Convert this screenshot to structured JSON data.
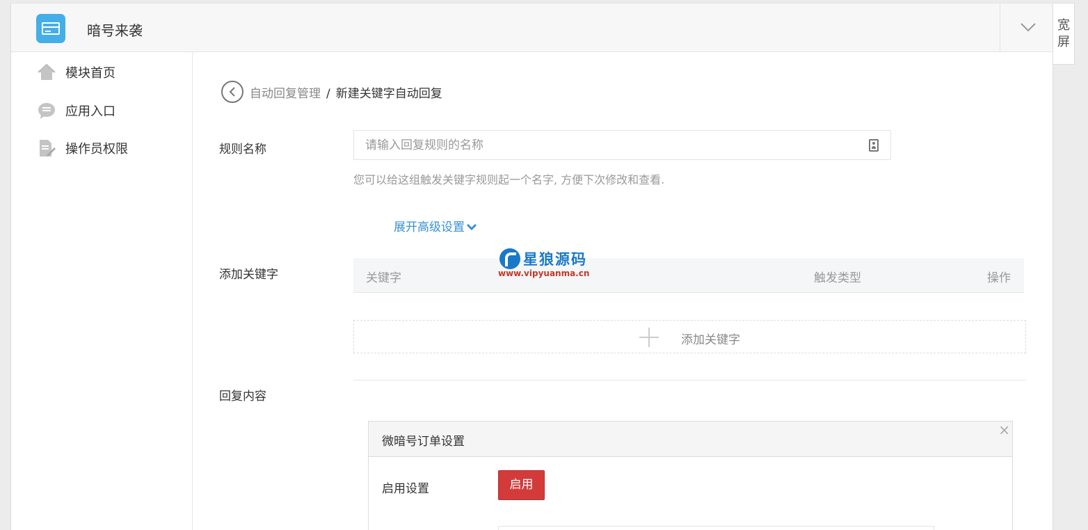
{
  "app": {
    "title": "暗号来袭",
    "widescreen_label": "宽屏"
  },
  "sidebar": {
    "items": [
      {
        "label": "模块首页",
        "icon": "home-icon"
      },
      {
        "label": "应用入口",
        "icon": "chat-icon"
      },
      {
        "label": "操作员权限",
        "icon": "edit-doc-icon"
      }
    ]
  },
  "breadcrumb": {
    "parent": "自动回复管理",
    "separator": "/",
    "current": "新建关键字自动回复"
  },
  "form": {
    "rule_name_label": "规则名称",
    "rule_name_placeholder": "请输入回复规则的名称",
    "rule_name_value": "",
    "rule_name_help": "您可以给这组触发关键字规则起一个名字, 方便下次修改和查看.",
    "advanced_link": "展开高级设置",
    "add_keyword_label": "添加关键字",
    "keyword_table": {
      "columns": [
        "关键字",
        "触发类型",
        "操作"
      ]
    },
    "add_keyword_button": "添加关键字",
    "reply_content_label": "回复内容"
  },
  "panel": {
    "title": "微暗号订单设置",
    "close": "×",
    "setting_label": "启用设置",
    "enable_button": "启用"
  },
  "watermark": {
    "name": "星狼源码",
    "url": "www.vipyuanma.cn"
  },
  "colors": {
    "link": "#3a91d4",
    "danger": "#d33b3b",
    "logo": "#44aee8"
  }
}
